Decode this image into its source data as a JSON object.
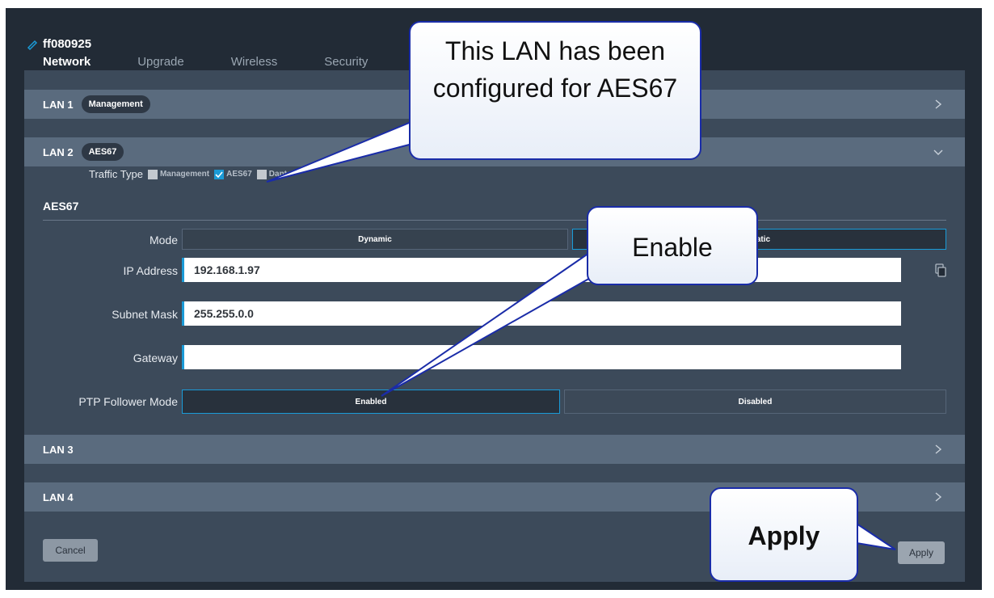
{
  "device": {
    "name": "ff080925",
    "icon": "pencil-icon"
  },
  "tabs": [
    {
      "label": "Network",
      "active": true
    },
    {
      "label": "Upgrade",
      "active": false
    },
    {
      "label": "Wireless",
      "active": false
    },
    {
      "label": "Security",
      "active": false
    }
  ],
  "lans": [
    {
      "label": "LAN 1",
      "badge": "Management",
      "expanded": false
    },
    {
      "label": "LAN 2",
      "badge": "AES67",
      "expanded": true
    },
    {
      "label": "LAN 3",
      "badge": "",
      "expanded": false
    },
    {
      "label": "LAN 4",
      "badge": "",
      "expanded": false
    }
  ],
  "traffic_type": {
    "label": "Traffic Type",
    "options": [
      {
        "label": "Management",
        "checked": false
      },
      {
        "label": "AES67",
        "checked": true
      },
      {
        "label": "Dante",
        "checked": false
      }
    ]
  },
  "aes67": {
    "title": "AES67",
    "mode": {
      "label": "Mode",
      "options": [
        "Dynamic",
        "Static"
      ],
      "selected": "Static"
    },
    "ip_address": {
      "label": "IP Address",
      "value": "192.168.1.97"
    },
    "subnet_mask": {
      "label": "Subnet Mask",
      "value": "255.255.0.0"
    },
    "gateway": {
      "label": "Gateway",
      "value": ""
    },
    "ptp": {
      "label": "PTP Follower Mode",
      "options": [
        "Enabled",
        "Disabled"
      ],
      "selected": "Enabled"
    }
  },
  "buttons": {
    "cancel": "Cancel",
    "apply": "Apply"
  },
  "callouts": {
    "lan": "This LAN has been configured for AES67",
    "enable": "Enable",
    "apply": "Apply"
  },
  "colors": {
    "accent": "#1a9bd7",
    "panel": "#3c4a5a",
    "row": "#5a6b7e",
    "callout_border": "#1a2ca8"
  }
}
